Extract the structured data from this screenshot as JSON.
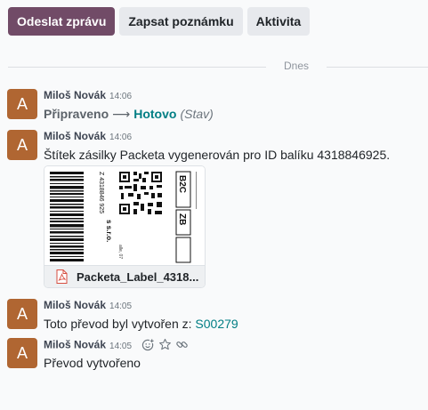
{
  "toolbar": {
    "send_message": "Odeslat zprávu",
    "log_note": "Zapsat poznámku",
    "activity": "Aktivita"
  },
  "separator": {
    "label": "Dnes"
  },
  "messages": [
    {
      "avatar": "A",
      "author": "Miloš Novák",
      "time": "14:06",
      "tracking": {
        "old": "Připraveno",
        "arrow": "⟶",
        "new": "Hotovo",
        "field": "(Stav)"
      }
    },
    {
      "avatar": "A",
      "author": "Miloš Novák",
      "time": "14:06",
      "text": "Štítek zásilky Packeta vygenerován pro ID balíku 4318846925.",
      "attachment": {
        "name": "Packeta_Label_4318...",
        "preview": {
          "code_vertical": "Z 4318846 925",
          "route_code": "B2C",
          "country": "ZB",
          "company": "s s.r.o.",
          "small": "alle, 07"
        }
      }
    },
    {
      "avatar": "A",
      "author": "Miloš Novák",
      "time": "14:05",
      "text_before": "Toto převod byl vytvořen z: ",
      "link": "S00279"
    },
    {
      "avatar": "A",
      "author": "Miloš Novák",
      "time": "14:05",
      "text": "Převod vytvořeno"
    }
  ],
  "colors": {
    "primary": "#714b67",
    "avatar": "#b06632",
    "link": "#017e84",
    "pdf": "#d64d3f"
  }
}
